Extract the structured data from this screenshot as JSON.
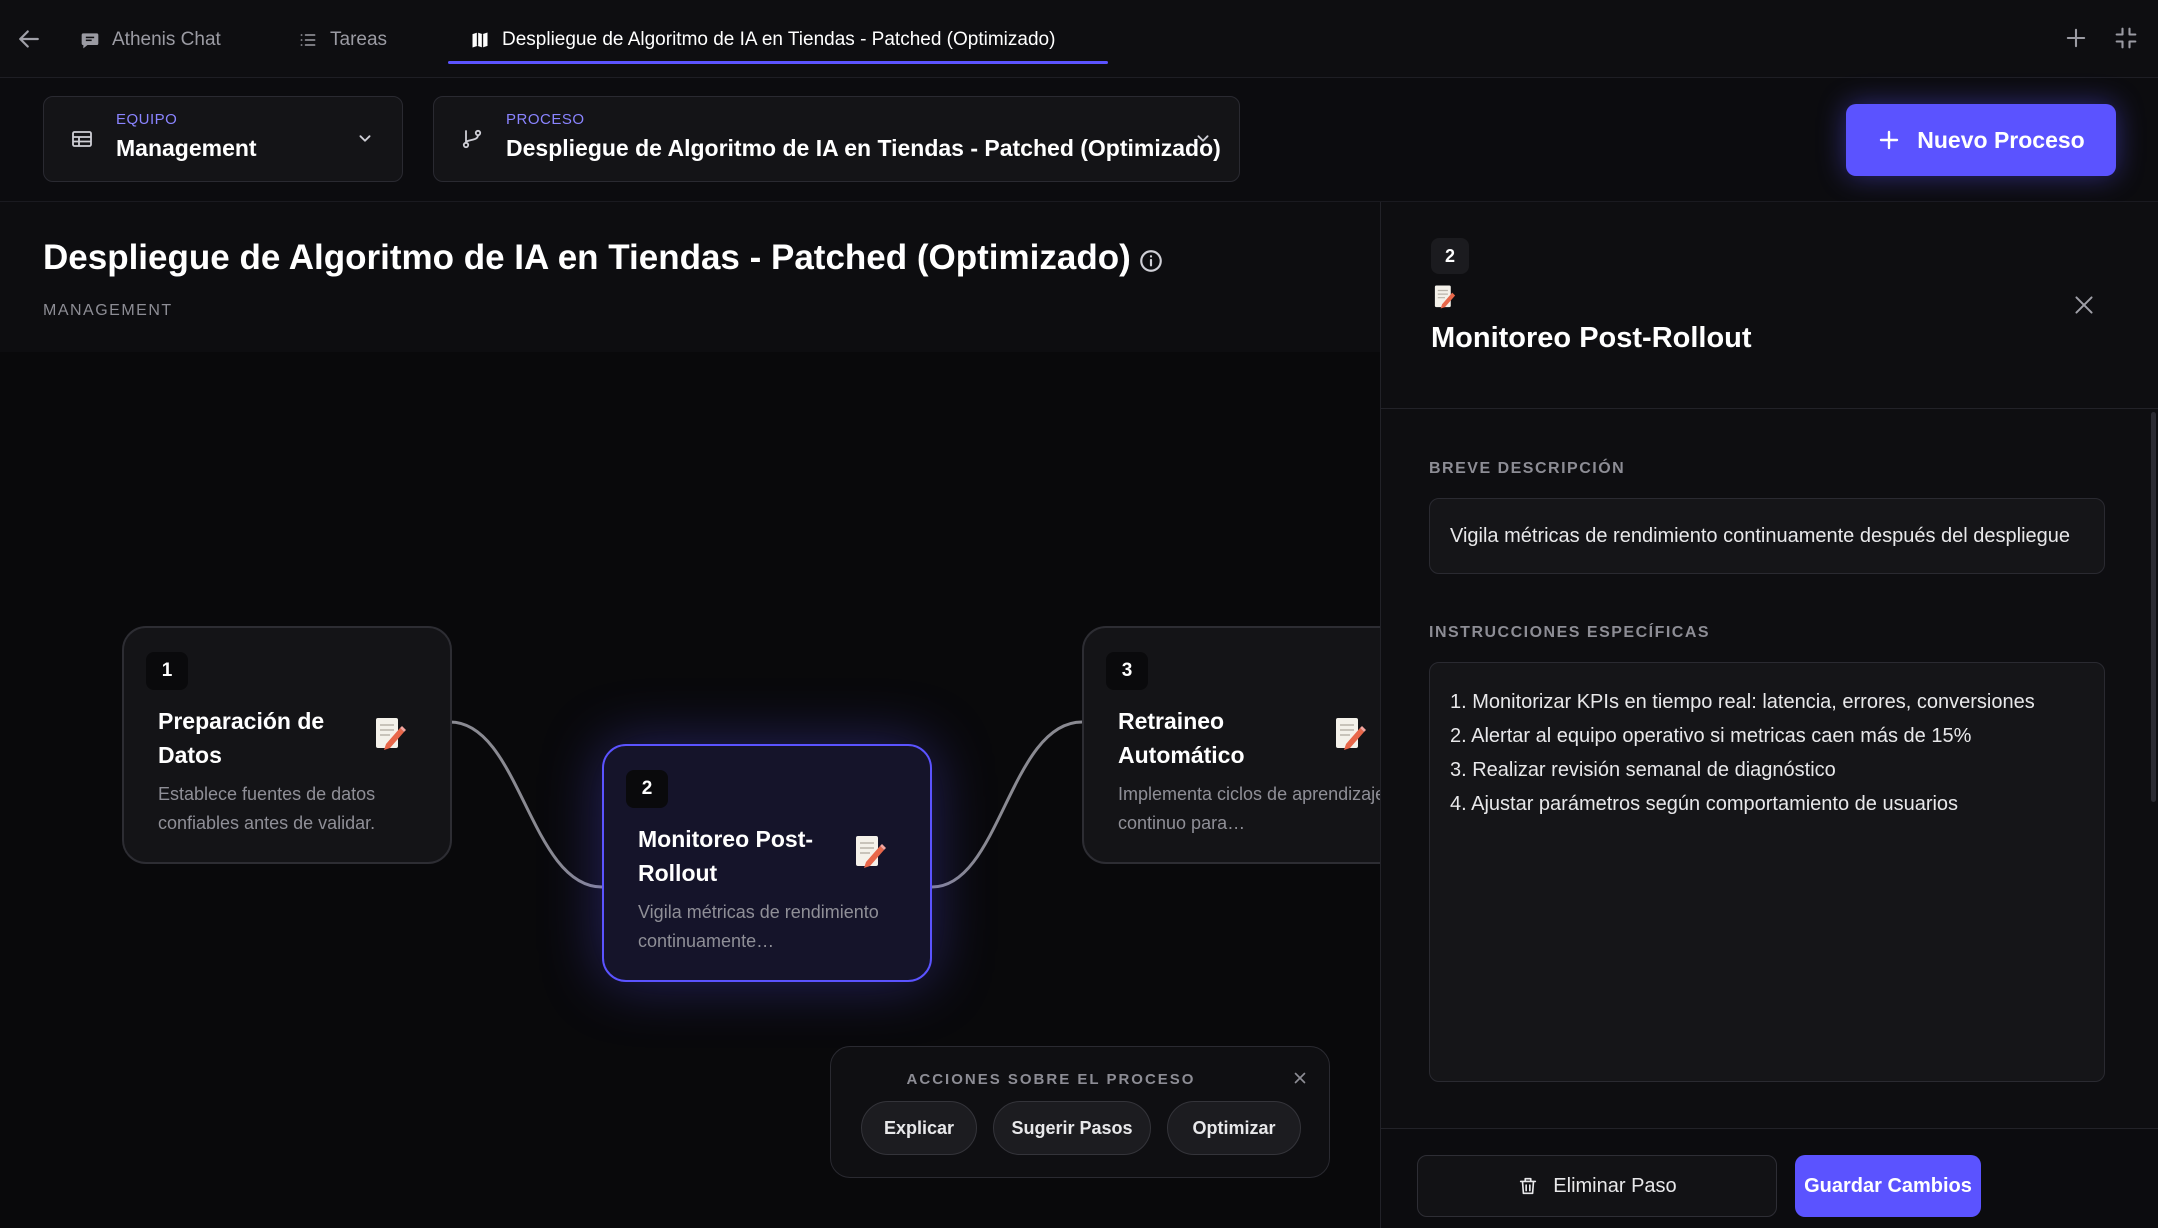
{
  "tabs": [
    {
      "label": "Athenis Chat",
      "icon": "chat-icon"
    },
    {
      "label": "Tareas",
      "icon": "list-icon"
    },
    {
      "label": "Despliegue de Algoritmo de IA en Tiendas - Patched (Optimizado)",
      "icon": "map-icon",
      "active": true
    }
  ],
  "selectors": {
    "team": {
      "label": "EQUIPO",
      "value": "Management"
    },
    "process": {
      "label": "PROCESO",
      "value": "Despliegue de Algoritmo de IA en Tiendas - Patched (Optimizado)"
    }
  },
  "new_process_label": "Nuevo Proceso",
  "canvas": {
    "title": "Despliegue de Algoritmo de IA en Tiendas - Patched (Optimizado)",
    "subtitle": "MANAGEMENT"
  },
  "nodes": [
    {
      "number": "1",
      "title": "Preparación de Datos",
      "description": "Establece fuentes de datos confiables antes de validar."
    },
    {
      "number": "2",
      "title": "Monitoreo Post-Rollout",
      "description": "Vigila métricas de rendimiento continuamente…",
      "selected": true
    },
    {
      "number": "3",
      "title": "Retraineo Automático",
      "description": "Implementa ciclos de aprendizaje continuo para…"
    }
  ],
  "actions": {
    "title": "ACCIONES SOBRE EL PROCESO",
    "buttons": [
      "Explicar",
      "Sugerir Pasos",
      "Optimizar"
    ]
  },
  "panel": {
    "number": "2",
    "title": "Monitoreo Post-Rollout",
    "desc_label": "BREVE DESCRIPCIÓN",
    "desc_value": "Vigila métricas de rendimiento continuamente después del despliegue",
    "instr_label": "INSTRUCCIONES ESPECÍFICAS",
    "instructions": [
      "1. Monitorizar KPIs en tiempo real: latencia, errores, conversiones",
      "2. Alertar al equipo operativo si metricas caen más de 15%",
      "3. Realizar revisión semanal de diagnóstico",
      "4. Ajustar parámetros según comportamiento de usuarios"
    ],
    "delete_label": "Eliminar Paso",
    "save_label": "Guardar Cambios"
  },
  "colors": {
    "accent": "#5b53ff",
    "background": "#0b0b0d",
    "card": "#141417"
  }
}
